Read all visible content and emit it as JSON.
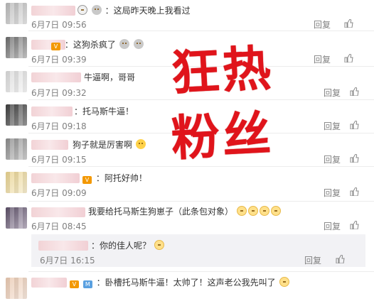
{
  "comments": [
    {
      "text": "：这局昨天晚上我看过",
      "time": "6月7日 09:56"
    },
    {
      "text": "：这狗杀疯了",
      "time": "6月7日 09:39"
    },
    {
      "text": "牛逼啊，哥哥",
      "time": "6月7日 09:32"
    },
    {
      "text": "：托马斯牛逼！",
      "time": "6月7日 09:18"
    },
    {
      "text": "狗子就是厉害啊",
      "time": "6月7日 09:15"
    },
    {
      "text": "：阿托好帅！",
      "time": "6月7日 09:09"
    },
    {
      "text": "我要给托马斯生狗崽子（此条包对象）",
      "time": "6月7日 08:45"
    }
  ],
  "nested_reply": {
    "text": "：你的佳人呢？",
    "time": "6月7日 16:15"
  },
  "last_comment": {
    "text": "：卧槽托马斯牛逼！太帅了！这声老公我先叫了"
  },
  "actions": {
    "reply_label": "回复"
  },
  "overlay": {
    "line1": "狂热",
    "line2": "粉丝"
  },
  "colors": {
    "overlay": "#e0141b",
    "badge": "#f39800",
    "muted": "#808080"
  }
}
